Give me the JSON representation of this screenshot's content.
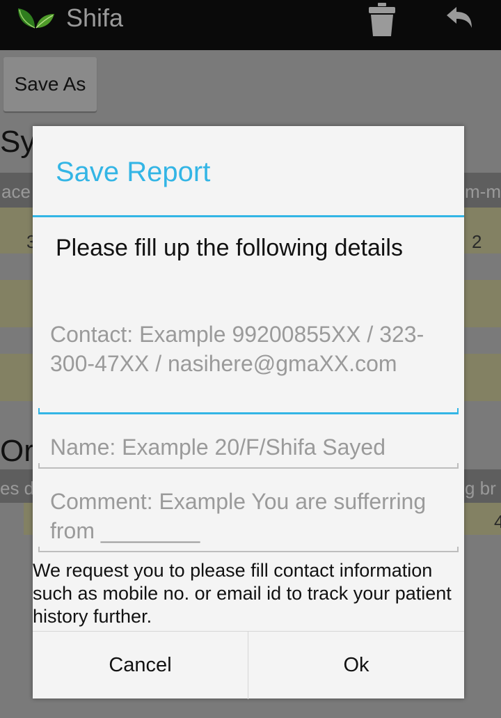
{
  "app": {
    "title": "Shifa",
    "logo_icon": "leaf-logo-icon",
    "actions": [
      "trash-icon",
      "back-icon"
    ]
  },
  "background": {
    "save_as_label": "Save As",
    "section1_heading": "Sy",
    "section1_header_left": "ace",
    "section1_header_right": "m-m",
    "section1_row1_left": "3",
    "section1_row1_right": "2",
    "section2_heading": "Or",
    "section2_header_left": "es d",
    "section2_header_right": "g br",
    "section2_row1_right": "4"
  },
  "dialog": {
    "title": "Save Report",
    "message": "Please fill up the following details",
    "contact_placeholder": "Contact: Example 99200855XX / 323-300-47XX / nasihere@gmaXX.com",
    "name_placeholder": "Name: Example 20/F/Shifa Sayed",
    "comment_placeholder": "Comment: Example You are sufferring from ________",
    "info_text": "We request you to please fill contact information such as mobile no. or email id to track your patient history further.",
    "cancel_label": "Cancel",
    "ok_label": "Ok"
  },
  "colors": {
    "accent": "#33b5e5",
    "actionbar": "#0a0a0a",
    "dialog_bg": "#f4f4f4"
  }
}
